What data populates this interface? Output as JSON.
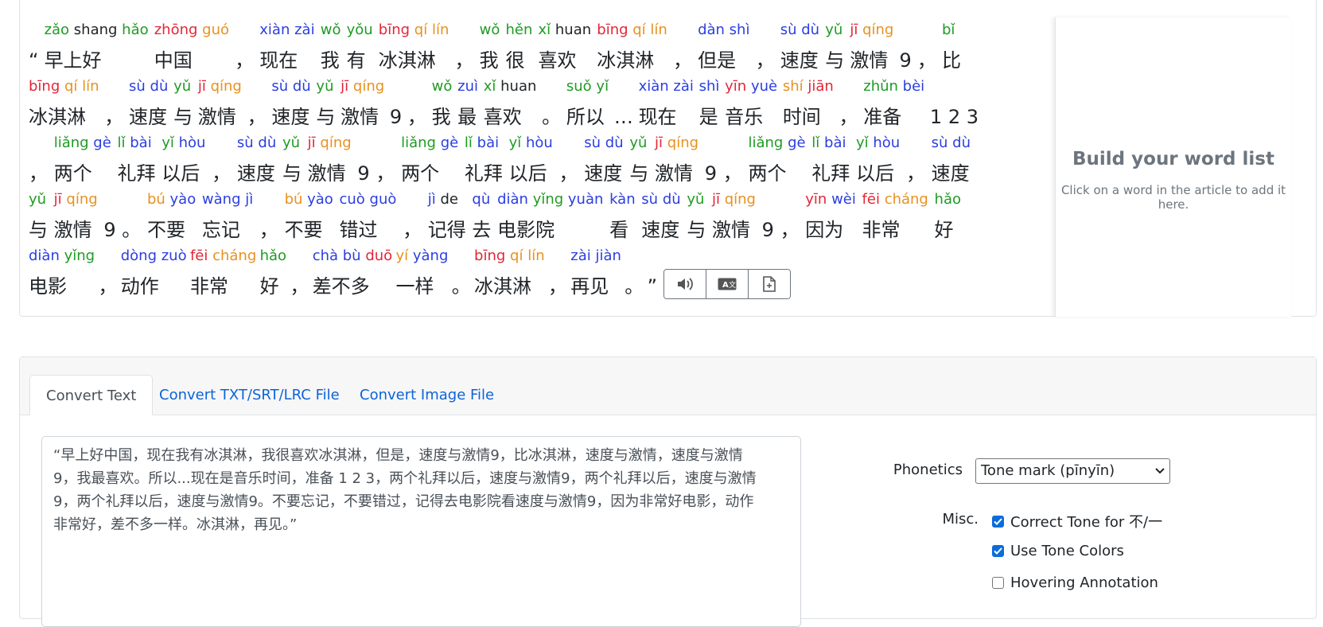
{
  "article": {
    "lines": [
      {
        "words": [
          {
            "hz": "“",
            "syl": []
          },
          {
            "hz": "早上好",
            "syl": [
              [
                "zǎo",
                3
              ],
              [
                "shang",
                0
              ],
              [
                "hǎo",
                3
              ]
            ]
          },
          {
            "hz": "中国",
            "syl": [
              [
                "zhōng",
                1
              ],
              [
                "guó",
                2
              ]
            ]
          },
          {
            "hz": "，",
            "syl": []
          },
          {
            "hz": "现在",
            "syl": [
              [
                "xiàn",
                4
              ],
              [
                "zài",
                4
              ]
            ]
          },
          {
            "hz": "我",
            "syl": [
              [
                "wǒ",
                3
              ]
            ]
          },
          {
            "hz": "有",
            "syl": [
              [
                "yǒu",
                3
              ]
            ]
          },
          {
            "hz": "冰淇淋",
            "syl": [
              [
                "bīng",
                1
              ],
              [
                "qí",
                2
              ],
              [
                "lín",
                2
              ]
            ]
          },
          {
            "hz": "，",
            "syl": []
          },
          {
            "hz": "我",
            "syl": [
              [
                "wǒ",
                3
              ]
            ]
          },
          {
            "hz": "很",
            "syl": [
              [
                "hěn",
                3
              ]
            ]
          },
          {
            "hz": "喜欢",
            "syl": [
              [
                "xǐ",
                3
              ],
              [
                "huan",
                0
              ]
            ]
          },
          {
            "hz": "冰淇淋",
            "syl": [
              [
                "bīng",
                1
              ],
              [
                "qí",
                2
              ],
              [
                "lín",
                2
              ]
            ]
          },
          {
            "hz": "，",
            "syl": []
          },
          {
            "hz": "但是",
            "syl": [
              [
                "dàn",
                4
              ],
              [
                "shì",
                4
              ]
            ]
          },
          {
            "hz": "，",
            "syl": []
          },
          {
            "hz": "速度",
            "syl": [
              [
                "sù",
                4
              ],
              [
                "dù",
                4
              ]
            ]
          },
          {
            "hz": "与",
            "syl": [
              [
                "yǔ",
                3
              ]
            ]
          },
          {
            "hz": "激情",
            "syl": [
              [
                "jī",
                1
              ],
              [
                "qíng",
                2
              ]
            ]
          },
          {
            "hz": "9",
            "syl": []
          },
          {
            "hz": "，",
            "syl": []
          },
          {
            "hz": "比",
            "syl": [
              [
                "bǐ",
                3
              ]
            ]
          }
        ]
      },
      {
        "words": [
          {
            "hz": "冰淇淋",
            "syl": [
              [
                "bīng",
                1
              ],
              [
                "qí",
                2
              ],
              [
                "lín",
                2
              ]
            ]
          },
          {
            "hz": "，",
            "syl": []
          },
          {
            "hz": "速度",
            "syl": [
              [
                "sù",
                4
              ],
              [
                "dù",
                4
              ]
            ]
          },
          {
            "hz": "与",
            "syl": [
              [
                "yǔ",
                3
              ]
            ]
          },
          {
            "hz": "激情",
            "syl": [
              [
                "jī",
                1
              ],
              [
                "qíng",
                2
              ]
            ]
          },
          {
            "hz": "，",
            "syl": []
          },
          {
            "hz": "速度",
            "syl": [
              [
                "sù",
                4
              ],
              [
                "dù",
                4
              ]
            ]
          },
          {
            "hz": "与",
            "syl": [
              [
                "yǔ",
                3
              ]
            ]
          },
          {
            "hz": "激情",
            "syl": [
              [
                "jī",
                1
              ],
              [
                "qíng",
                2
              ]
            ]
          },
          {
            "hz": "9",
            "syl": []
          },
          {
            "hz": "，",
            "syl": []
          },
          {
            "hz": "我",
            "syl": [
              [
                "wǒ",
                3
              ]
            ]
          },
          {
            "hz": "最",
            "syl": [
              [
                "zuì",
                4
              ]
            ]
          },
          {
            "hz": "喜欢",
            "syl": [
              [
                "xǐ",
                3
              ],
              [
                "huan",
                0
              ]
            ]
          },
          {
            "hz": "。",
            "syl": []
          },
          {
            "hz": "所以",
            "syl": [
              [
                "suǒ",
                3
              ],
              [
                "yǐ",
                3
              ]
            ]
          },
          {
            "hz": "…",
            "syl": []
          },
          {
            "hz": "现在",
            "syl": [
              [
                "xiàn",
                4
              ],
              [
                "zài",
                4
              ]
            ]
          },
          {
            "hz": "是",
            "syl": [
              [
                "shì",
                4
              ]
            ]
          },
          {
            "hz": "音乐",
            "syl": [
              [
                "yīn",
                1
              ],
              [
                "yuè",
                4
              ]
            ]
          },
          {
            "hz": "时间",
            "syl": [
              [
                "shí",
                2
              ],
              [
                "jiān",
                1
              ]
            ]
          },
          {
            "hz": "，",
            "syl": []
          },
          {
            "hz": "准备",
            "syl": [
              [
                "zhǔn",
                3
              ],
              [
                "bèi",
                4
              ]
            ]
          },
          {
            "hz": "1 2 3",
            "syl": []
          }
        ]
      },
      {
        "words": [
          {
            "hz": "，",
            "syl": []
          },
          {
            "hz": "两个",
            "syl": [
              [
                "liǎng",
                3
              ],
              [
                "gè",
                4
              ]
            ]
          },
          {
            "hz": "礼拜",
            "syl": [
              [
                "lǐ",
                3
              ],
              [
                "bài",
                4
              ]
            ]
          },
          {
            "hz": "以后",
            "syl": [
              [
                "yǐ",
                3
              ],
              [
                "hòu",
                4
              ]
            ]
          },
          {
            "hz": "，",
            "syl": []
          },
          {
            "hz": "速度",
            "syl": [
              [
                "sù",
                4
              ],
              [
                "dù",
                4
              ]
            ]
          },
          {
            "hz": "与",
            "syl": [
              [
                "yǔ",
                3
              ]
            ]
          },
          {
            "hz": "激情",
            "syl": [
              [
                "jī",
                1
              ],
              [
                "qíng",
                2
              ]
            ]
          },
          {
            "hz": "9",
            "syl": []
          },
          {
            "hz": "，",
            "syl": []
          },
          {
            "hz": "两个",
            "syl": [
              [
                "liǎng",
                3
              ],
              [
                "gè",
                4
              ]
            ]
          },
          {
            "hz": "礼拜",
            "syl": [
              [
                "lǐ",
                3
              ],
              [
                "bài",
                4
              ]
            ]
          },
          {
            "hz": "以后",
            "syl": [
              [
                "yǐ",
                3
              ],
              [
                "hòu",
                4
              ]
            ]
          },
          {
            "hz": "，",
            "syl": []
          },
          {
            "hz": "速度",
            "syl": [
              [
                "sù",
                4
              ],
              [
                "dù",
                4
              ]
            ]
          },
          {
            "hz": "与",
            "syl": [
              [
                "yǔ",
                3
              ]
            ]
          },
          {
            "hz": "激情",
            "syl": [
              [
                "jī",
                1
              ],
              [
                "qíng",
                2
              ]
            ]
          },
          {
            "hz": "9",
            "syl": []
          },
          {
            "hz": "，",
            "syl": []
          },
          {
            "hz": "两个",
            "syl": [
              [
                "liǎng",
                3
              ],
              [
                "gè",
                4
              ]
            ]
          },
          {
            "hz": "礼拜",
            "syl": [
              [
                "lǐ",
                3
              ],
              [
                "bài",
                4
              ]
            ]
          },
          {
            "hz": "以后",
            "syl": [
              [
                "yǐ",
                3
              ],
              [
                "hòu",
                4
              ]
            ]
          },
          {
            "hz": "，",
            "syl": []
          },
          {
            "hz": "速度",
            "syl": [
              [
                "sù",
                4
              ],
              [
                "dù",
                4
              ]
            ]
          }
        ]
      },
      {
        "words": [
          {
            "hz": "与",
            "syl": [
              [
                "yǔ",
                3
              ]
            ]
          },
          {
            "hz": "激情",
            "syl": [
              [
                "jī",
                1
              ],
              [
                "qíng",
                2
              ]
            ]
          },
          {
            "hz": "9",
            "syl": []
          },
          {
            "hz": "。",
            "syl": []
          },
          {
            "hz": "不要",
            "syl": [
              [
                "bú",
                2
              ],
              [
                "yào",
                4
              ]
            ]
          },
          {
            "hz": "忘记",
            "syl": [
              [
                "wàng",
                4
              ],
              [
                "jì",
                4
              ]
            ]
          },
          {
            "hz": "，",
            "syl": []
          },
          {
            "hz": "不要",
            "syl": [
              [
                "bú",
                2
              ],
              [
                "yào",
                4
              ]
            ]
          },
          {
            "hz": "错过",
            "syl": [
              [
                "cuò",
                4
              ],
              [
                "guò",
                4
              ]
            ]
          },
          {
            "hz": "，",
            "syl": []
          },
          {
            "hz": "记得",
            "syl": [
              [
                "jì",
                4
              ],
              [
                "de",
                0
              ]
            ]
          },
          {
            "hz": "去",
            "syl": [
              [
                "qù",
                4
              ]
            ]
          },
          {
            "hz": "电影院",
            "syl": [
              [
                "diàn",
                4
              ],
              [
                "yǐng",
                3
              ],
              [
                "yuàn",
                4
              ]
            ]
          },
          {
            "hz": "看",
            "syl": [
              [
                "kàn",
                4
              ]
            ]
          },
          {
            "hz": "速度",
            "syl": [
              [
                "sù",
                4
              ],
              [
                "dù",
                4
              ]
            ]
          },
          {
            "hz": "与",
            "syl": [
              [
                "yǔ",
                3
              ]
            ]
          },
          {
            "hz": "激情",
            "syl": [
              [
                "jī",
                1
              ],
              [
                "qíng",
                2
              ]
            ]
          },
          {
            "hz": "9",
            "syl": []
          },
          {
            "hz": "，",
            "syl": []
          },
          {
            "hz": "因为",
            "syl": [
              [
                "yīn",
                1
              ],
              [
                "wèi",
                4
              ]
            ]
          },
          {
            "hz": "非常",
            "syl": [
              [
                "fēi",
                1
              ],
              [
                "cháng",
                2
              ]
            ]
          },
          {
            "hz": "好",
            "syl": [
              [
                "hǎo",
                3
              ]
            ]
          }
        ]
      },
      {
        "words": [
          {
            "hz": "电影",
            "syl": [
              [
                "diàn",
                4
              ],
              [
                "yǐng",
                3
              ]
            ]
          },
          {
            "hz": "，",
            "syl": []
          },
          {
            "hz": "动作",
            "syl": [
              [
                "dòng",
                4
              ],
              [
                "zuò",
                4
              ]
            ]
          },
          {
            "hz": "非常",
            "syl": [
              [
                "fēi",
                1
              ],
              [
                "cháng",
                2
              ]
            ]
          },
          {
            "hz": "好",
            "syl": [
              [
                "hǎo",
                3
              ]
            ]
          },
          {
            "hz": "，",
            "syl": []
          },
          {
            "hz": "差不多",
            "syl": [
              [
                "chà",
                4
              ],
              [
                "bù",
                4
              ],
              [
                "duō",
                1
              ]
            ]
          },
          {
            "hz": "一样",
            "syl": [
              [
                "yí",
                2
              ],
              [
                "yàng",
                4
              ]
            ]
          },
          {
            "hz": "。",
            "syl": []
          },
          {
            "hz": "冰淇淋",
            "syl": [
              [
                "bīng",
                1
              ],
              [
                "qí",
                2
              ],
              [
                "lín",
                2
              ]
            ]
          },
          {
            "hz": "，",
            "syl": []
          },
          {
            "hz": "再见",
            "syl": [
              [
                "zài",
                4
              ],
              [
                "jiàn",
                4
              ]
            ]
          },
          {
            "hz": "。",
            "syl": []
          },
          {
            "hz": "”",
            "syl": []
          }
        ]
      }
    ],
    "buttons": [
      {
        "name": "speak-button",
        "icon": "speaker-icon"
      },
      {
        "name": "translate-button",
        "icon": "translate-icon"
      },
      {
        "name": "export-button",
        "icon": "file-export-icon"
      }
    ]
  },
  "word_list": {
    "title": "Build your word list",
    "subtitle": "Click on a word in the article to add it here."
  },
  "tabs": [
    {
      "label": "Convert Text",
      "active": true
    },
    {
      "label": "Convert TXT/SRT/LRC File",
      "active": false
    },
    {
      "label": "Convert Image File",
      "active": false
    }
  ],
  "input_text": "“早上好中国，现在我有冰淇淋，我很喜欢冰淇淋，但是，速度与激情9，比冰淇淋，速度与激情，速度与激情9，我最喜欢。所以...现在是音乐时间，准备 1 2 3，两个礼拜以后，速度与激情9，两个礼拜以后，速度与激情9，两个礼拜以后，速度与激情9。不要忘记，不要错过，记得去电影院看速度与激情9，因为非常好电影，动作非常好，差不多一样。冰淇淋，再见。”",
  "input_lines": [
    "“早上好中国，现在我有冰淇淋，我很喜欢冰淇淋，但是，速度与激情9，比冰淇淋，速度与激情，速度与激情",
    "9，我最喜欢。所以...现在是音乐时间，准备 1 2 3，两个礼拜以后，速度与激情9，两个礼拜以后，速度与激情",
    "9，两个礼拜以后，速度与激情9。不要忘记，不要错过，记得去电影院看速度与激情9，因为非常好电影，动作",
    "非常好，差不多一样。冰淇淋，再见。”"
  ],
  "options": {
    "phonetics_label": "Phonetics",
    "phonetics_value": "Tone mark (pīnyīn)",
    "misc_label": "Misc.",
    "checkboxes": [
      {
        "label": "Correct Tone for 不/一",
        "checked": true
      },
      {
        "label": "Use Tone Colors",
        "checked": true
      },
      {
        "label": "Hovering Annotation",
        "checked": false
      }
    ]
  },
  "tone_colors": {
    "0": "#212529",
    "1": "#e32636",
    "2": "#e8911f",
    "3": "#1f9b23",
    "4": "#2b3ee0"
  }
}
